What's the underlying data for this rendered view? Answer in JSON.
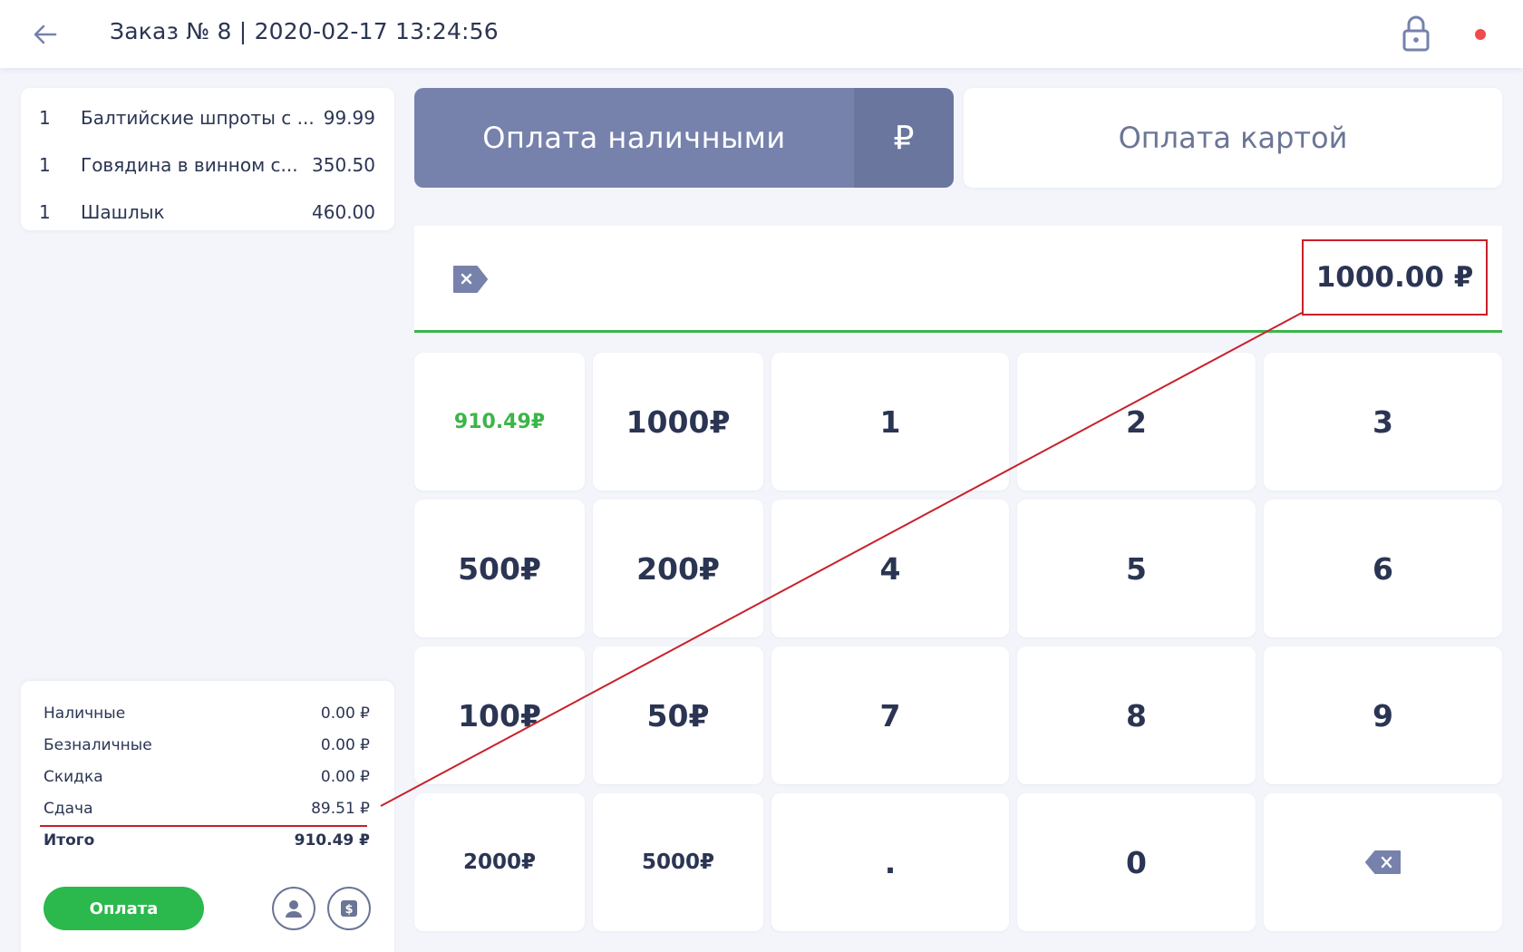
{
  "header": {
    "title": "Заказ № 8 | 2020-02-17 13:24:56",
    "back_icon": "arrow-left-icon",
    "lock_icon": "lock-icon",
    "status_color": "#f04a4a"
  },
  "order_items": [
    {
      "qty": "1",
      "name": "Балтийские шпроты с ...",
      "price": "99.99"
    },
    {
      "qty": "1",
      "name": "Говядина в винном с...",
      "price": "350.50"
    },
    {
      "qty": "1",
      "name": "Шашлык",
      "price": "460.00"
    }
  ],
  "payment_tabs": {
    "cash_label": "Оплата наличными",
    "cash_currency": "₽",
    "card_label": "Оплата картой"
  },
  "amount_input": {
    "value": "1000.00  ₽"
  },
  "keypad": {
    "keys": [
      "910.49₽",
      "1000₽",
      "1",
      "2",
      "3",
      "500₽",
      "200₽",
      "4",
      "5",
      "6",
      "100₽",
      "50₽",
      "7",
      "8",
      "9",
      "2000₽",
      "5000₽",
      ".",
      "0"
    ],
    "backspace_icon": "backspace-icon"
  },
  "summary": {
    "cash_label": "Наличные",
    "cash_value": "0.00 ₽",
    "cashless_label": "Безналичные",
    "cashless_value": "0.00 ₽",
    "discount_label": "Скидка",
    "discount_value": "0.00 ₽",
    "change_label": "Сдача",
    "change_value": "89.51 ₽",
    "total_label": "Итого",
    "total_value": "910.49 ₽",
    "pay_button": "Оплата"
  },
  "colors": {
    "accent_green": "#3cb54a",
    "cash_tab": "#7682ac",
    "annotation_red": "#c8202a"
  }
}
